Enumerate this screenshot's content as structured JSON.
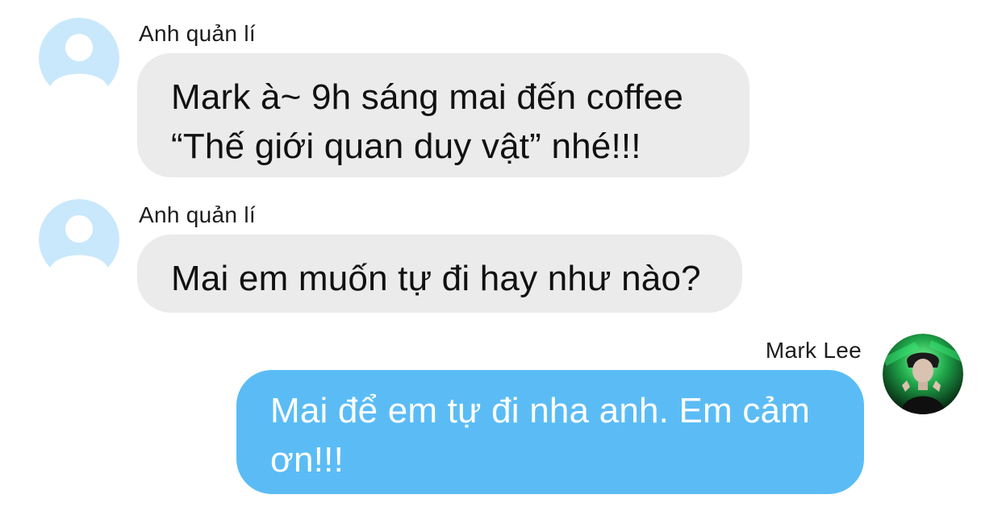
{
  "messages": [
    {
      "sender": "Anh quản lí",
      "lines": [
        "Mark à~ 9h sáng mai đến coffee",
        "“Thế giới quan duy vật” nhé!!!"
      ],
      "direction": "incoming",
      "avatar": "default-user-icon"
    },
    {
      "sender": "Anh quản lí",
      "lines": [
        "Mai em muốn tự đi hay như nào?"
      ],
      "direction": "incoming",
      "avatar": "default-user-icon"
    },
    {
      "sender": "Mark Lee",
      "lines": [
        "Mai để em tự đi nha anh. Em cảm",
        "ơn!!!"
      ],
      "direction": "outgoing",
      "avatar": "profile-photo"
    }
  ],
  "colors": {
    "incoming_bubble": "#ebebeb",
    "outgoing_bubble": "#5bbcf5",
    "incoming_text": "#111111",
    "outgoing_text": "#ffffff",
    "default_avatar": "#c9e8fb"
  }
}
